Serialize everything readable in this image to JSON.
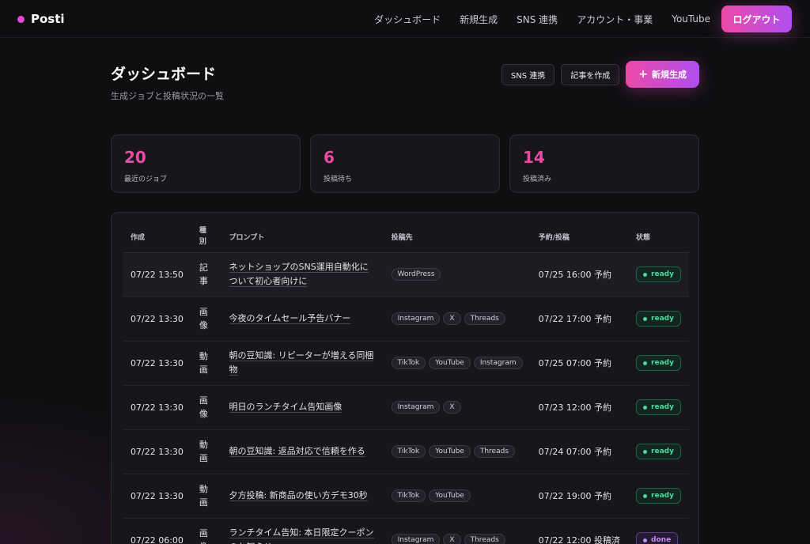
{
  "brand": {
    "name": "Posti"
  },
  "nav": {
    "items": [
      "ダッシュボード",
      "新規生成",
      "SNS 連携",
      "アカウント・事業",
      "YouTube"
    ],
    "logout": "ログアウト"
  },
  "page": {
    "title": "ダッシュボード",
    "subtitle": "生成ジョブと投稿状況の一覧",
    "actions": {
      "sns": "SNS 連携",
      "article": "記事を作成",
      "new": "新規生成",
      "new_icon": "+"
    }
  },
  "stats": [
    {
      "value": "20",
      "label": "最近のジョブ"
    },
    {
      "value": "6",
      "label": "投稿待ち"
    },
    {
      "value": "14",
      "label": "投稿済み"
    }
  ],
  "table": {
    "headers": {
      "created": "作成",
      "type": "種別",
      "prompt": "プロンプト",
      "dest": "投稿先",
      "schedule": "予約/投稿",
      "status": "状態"
    },
    "rows": [
      {
        "date": "07/22 13:50",
        "type": "記事",
        "prompt": "ネットショップのSNS運用自動化について初心者向けに",
        "dest": [
          "WordPress"
        ],
        "schedule": "07/25 16:00 予約",
        "status": "ready"
      },
      {
        "date": "07/22 13:30",
        "type": "画像",
        "prompt": "今夜のタイムセール予告バナー",
        "dest": [
          "Instagram",
          "X",
          "Threads"
        ],
        "schedule": "07/22 17:00 予約",
        "status": "ready"
      },
      {
        "date": "07/22 13:30",
        "type": "動画",
        "prompt": "朝の豆知識: リピーターが増える同梱物",
        "dest": [
          "TikTok",
          "YouTube",
          "Instagram"
        ],
        "schedule": "07/25 07:00 予約",
        "status": "ready"
      },
      {
        "date": "07/22 13:30",
        "type": "画像",
        "prompt": "明日のランチタイム告知画像",
        "dest": [
          "Instagram",
          "X"
        ],
        "schedule": "07/23 12:00 予約",
        "status": "ready"
      },
      {
        "date": "07/22 13:30",
        "type": "動画",
        "prompt": "朝の豆知識: 返品対応で信頼を作る",
        "dest": [
          "TikTok",
          "YouTube",
          "Threads"
        ],
        "schedule": "07/24 07:00 予約",
        "status": "ready"
      },
      {
        "date": "07/22 13:30",
        "type": "動画",
        "prompt": "夕方投稿: 新商品の使い方デモ30秒",
        "dest": [
          "TikTok",
          "YouTube"
        ],
        "schedule": "07/22 19:00 予約",
        "status": "ready"
      },
      {
        "date": "07/22 06:00",
        "type": "画像",
        "prompt": "ランチタイム告知: 本日限定クーポンのお知らせ",
        "dest": [
          "Instagram",
          "X",
          "Threads"
        ],
        "schedule": "07/22 12:00 投稿済",
        "status": "done"
      }
    ]
  },
  "colors": {
    "accent": "#ec4aa6",
    "accent2": "#b04ef0",
    "ready": "#49d9a0",
    "done": "#c78af5"
  }
}
